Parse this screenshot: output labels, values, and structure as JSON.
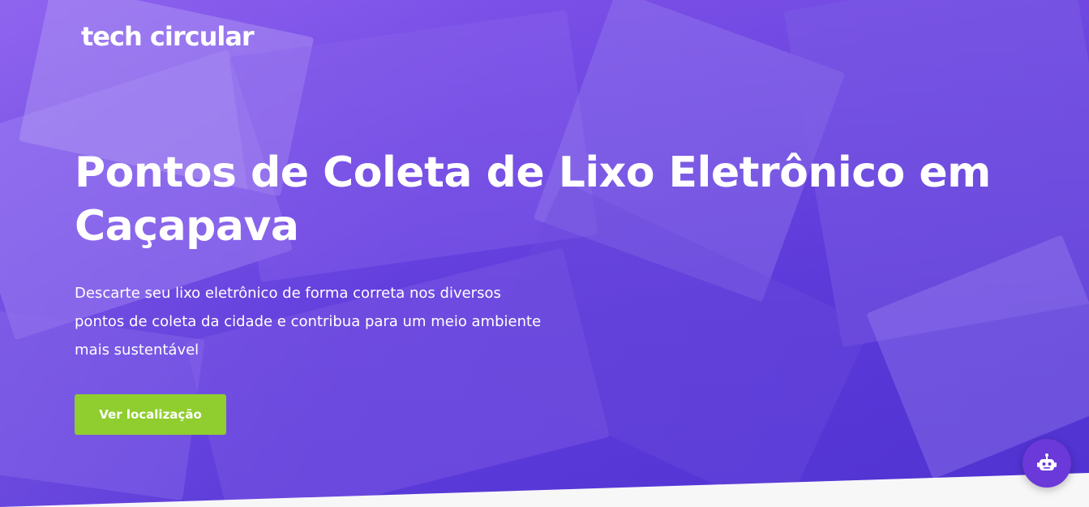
{
  "header": {
    "logo_text": "tech circular"
  },
  "hero": {
    "title": "Pontos de Coleta de Lixo Eletrônico em Caçapava",
    "subtitle": "Descarte seu lixo eletrônico de forma correta nos diversos pontos de coleta da cidade e contribua para um meio ambiente mais sustentável",
    "cta_label": "Ver localização"
  },
  "chat_widget": {
    "icon": "robot-icon"
  },
  "colors": {
    "overlay": "#6a3fe0",
    "cta": "#8fce2e",
    "chat": "#6b38d9",
    "bottom_band": "#f7f7f8"
  }
}
